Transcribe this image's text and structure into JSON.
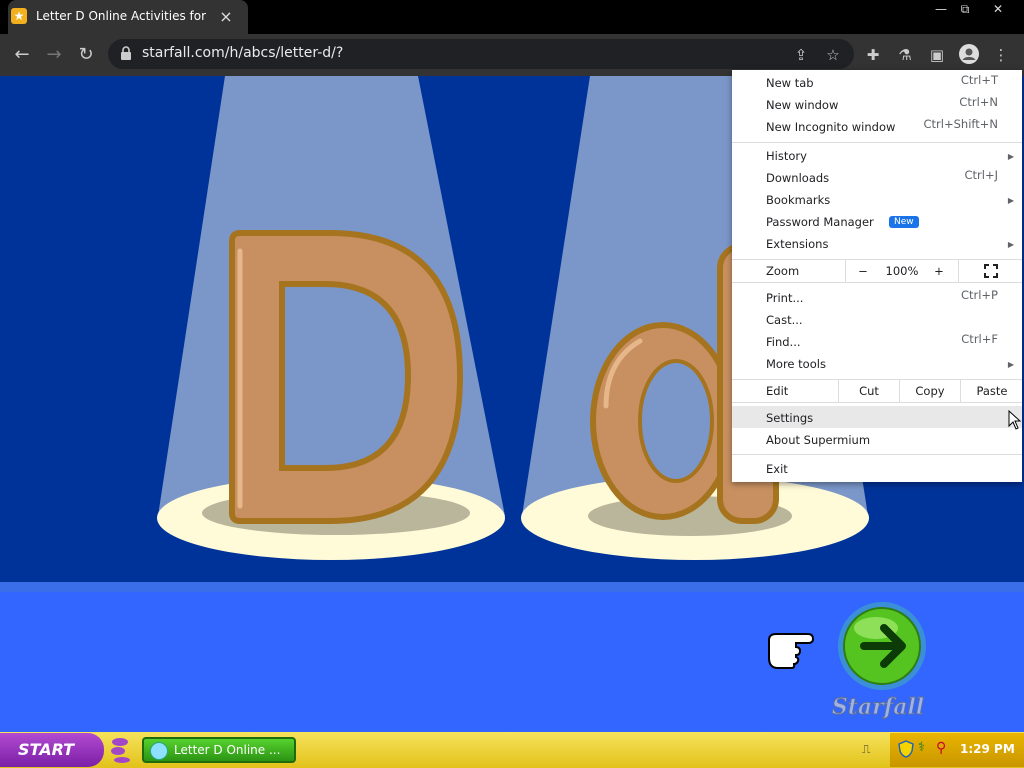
{
  "browser": {
    "tab_title": "Letter D Online Activities for K",
    "tab_close": "×",
    "url": "starfall.com/h/abcs/letter-d/?",
    "window_controls": {
      "minimize": "—",
      "restore": "⧉",
      "close": "✕"
    },
    "icons": [
      "back-arrow-icon",
      "forward-arrow-icon",
      "reload-icon",
      "lock-icon",
      "share-icon",
      "bookmark-star-icon",
      "extensions-puzzle-icon",
      "labs-flask-icon",
      "side-panel-icon",
      "profile-icon",
      "kebab-menu-icon"
    ]
  },
  "menu": {
    "new_tab": "New tab",
    "new_tab_sc": "Ctrl+T",
    "new_window": "New window",
    "new_window_sc": "Ctrl+N",
    "new_incognito": "New Incognito window",
    "new_incognito_sc": "Ctrl+Shift+N",
    "history": "History",
    "downloads": "Downloads",
    "downloads_sc": "Ctrl+J",
    "bookmarks": "Bookmarks",
    "password_manager": "Password Manager",
    "new_badge": "New",
    "extensions": "Extensions",
    "zoom": "Zoom",
    "zoom_minus": "−",
    "zoom_value": "100%",
    "zoom_plus": "+",
    "print": "Print...",
    "print_sc": "Ctrl+P",
    "cast": "Cast...",
    "find": "Find...",
    "find_sc": "Ctrl+F",
    "more_tools": "More tools",
    "edit": "Edit",
    "cut": "Cut",
    "copy": "Copy",
    "paste": "Paste",
    "settings": "Settings",
    "about": "About Supermium",
    "exit": "Exit"
  },
  "page": {
    "letter_upper": "D",
    "letter_lower": "d",
    "brand": "Starfall"
  },
  "taskbar": {
    "start": "START",
    "task_label": "Letter D Online ...",
    "clock": "1:29 PM"
  }
}
